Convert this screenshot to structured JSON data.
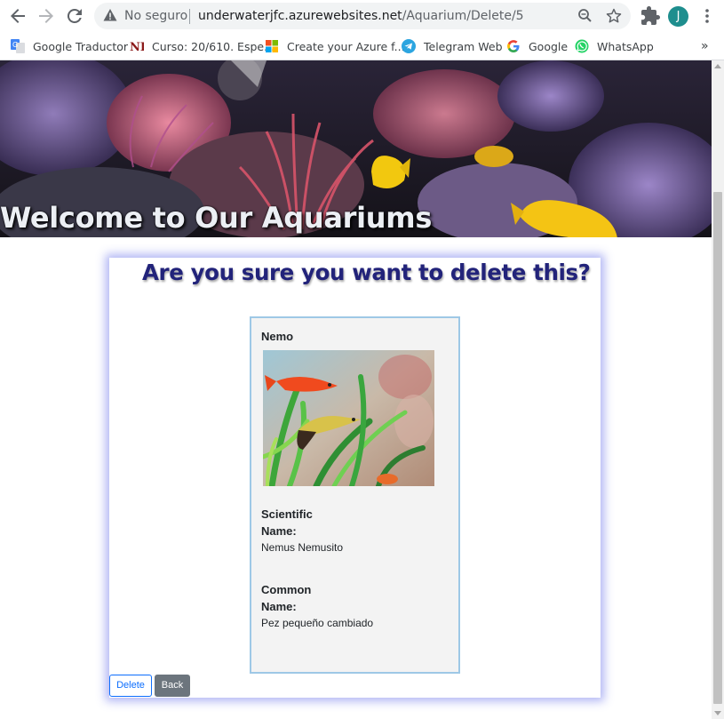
{
  "browser": {
    "security_label": "No seguro",
    "url_host": "underwaterjfc.azurewebsites.net",
    "url_path": "/Aquarium/Delete/5",
    "profile_initial": "J",
    "bookmarks": [
      {
        "label": "Google Traductor",
        "icon": "google-translate-icon"
      },
      {
        "label": "Curso: 20/610. Espe...",
        "icon": "ni-logo-icon"
      },
      {
        "label": "Create your Azure f...",
        "icon": "microsoft-logo-icon"
      },
      {
        "label": "Telegram Web",
        "icon": "telegram-icon"
      },
      {
        "label": "Google",
        "icon": "google-icon"
      },
      {
        "label": "WhatsApp",
        "icon": "whatsapp-icon"
      }
    ],
    "bookmarks_overflow": "»"
  },
  "banner": {
    "title": "Welcome to Our Aquariums"
  },
  "page": {
    "heading": "Are you sure you want to delete this?",
    "fish": {
      "name": "Nemo",
      "scientific_label_1": "Scientific",
      "scientific_label_2": "Name:",
      "scientific_name": "Nemus Nemusito",
      "common_label_1": "Common",
      "common_label_2": "Name:",
      "common_name": "Pez pequeño cambiado"
    },
    "buttons": {
      "delete": "Delete",
      "back": "Back"
    }
  },
  "colors": {
    "heading": "#22237a",
    "card_glow": "#5a64e6",
    "details_border": "#9ec8e6",
    "delete_outline": "#0d6efd",
    "back_fill": "#6c757d"
  }
}
